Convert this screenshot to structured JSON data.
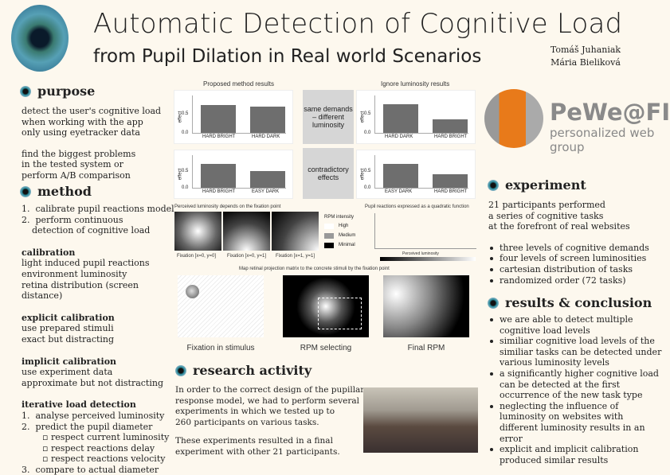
{
  "header": {
    "title": "Automatic Detection of Cognitive Load",
    "subtitle": "from Pupil Dilation in Real world Scenarios",
    "authors": [
      "Tomáš Juhaniak",
      "Mária Bieliková"
    ]
  },
  "logo": {
    "name": "PeWe@FIIT",
    "tagline": "personalized web group",
    "colors": {
      "orange": "#e87a1a",
      "gray": "#8a8a8a"
    }
  },
  "purpose": {
    "heading": "purpose",
    "p1": [
      "detect the user's cognitive load",
      "when working with the app",
      "only using eyetracker data"
    ],
    "p2": [
      "find the biggest problems",
      "in the tested system or",
      "perform A/B comparison"
    ]
  },
  "method": {
    "heading": "method",
    "steps": [
      "calibrate pupil reactions model",
      "perform continuous detection of cognitive load"
    ],
    "calibration": {
      "title": "calibration",
      "lines": [
        "light induced pupil reactions",
        "environment luminosity",
        "retina distribution (screen distance)"
      ]
    },
    "explicit": {
      "title": "explicit calibration",
      "lines": [
        "use prepared stimuli",
        "exact but distracting"
      ]
    },
    "implicit": {
      "title": "implicit calibration",
      "lines": [
        "use experiment data",
        "approximate but not distracting"
      ]
    },
    "iterative": {
      "title": "iterative load detection",
      "s1": "analyse perceived luminosity",
      "s2": "predict the pupil diameter",
      "sub": [
        "respect current luminosity",
        "respect reactions delay",
        "respect reactions velocity"
      ],
      "s3": "compare to actual diameter"
    }
  },
  "figures": {
    "proposed_title": "Proposed method results",
    "ignore_title": "Ignore luminosity results",
    "ylabel": "effect",
    "box1": "same demands – different luminosity",
    "box2": "contradictory effects",
    "charts": [
      {
        "categories": [
          "HARD BRIGHT",
          "HARD DARK"
        ],
        "values": [
          0.72,
          0.68
        ],
        "ticks": [
          "0.0",
          "0.5"
        ]
      },
      {
        "categories": [
          "HARD DARK",
          "HARD BRIGHT"
        ],
        "values": [
          0.75,
          0.35
        ],
        "ticks": [
          "0.0",
          "0.5"
        ]
      },
      {
        "categories": [
          "HARD BRIGHT",
          "EASY DARK"
        ],
        "values": [
          0.72,
          0.5
        ],
        "ticks": [
          "0.0",
          "0.5"
        ]
      },
      {
        "categories": [
          "EASY DARK",
          "HARD BRIGHT"
        ],
        "values": [
          0.72,
          0.4
        ],
        "ticks": [
          "0.0",
          "0.5"
        ]
      }
    ],
    "lum_caption": "Perceived luminosity depends on the fixation point",
    "fix_labels": [
      "Fixation [x=0, y=0]",
      "Fixation [x=0, y=1]",
      "Fixation [x=1, y=1]"
    ],
    "legend_title": "RPM intensity",
    "legend": [
      "High",
      "Medium",
      "Minimal"
    ],
    "quad_caption": "Pupil reactions expressed as a quadratic function",
    "quad_x": "Perceived luminosity",
    "map_caption": "Map retinal projection matrix to the concrete stimuli by the fixation point",
    "img_labels": [
      "Fixation in stimulus",
      "RPM selecting",
      "Final RPM"
    ]
  },
  "research": {
    "heading": "research activity",
    "p1": [
      "In order to  the correct design of the pupillary",
      "response model, we had to perform several",
      "experiments in which we tested up to",
      "260 participants on various tasks."
    ],
    "p2": [
      "These experiments resulted in a final",
      "experiment with other 21 participants."
    ]
  },
  "experiment": {
    "heading": "experiment",
    "lines": [
      "21 participants performed",
      "a series of cognitive tasks",
      "at the forefront of real websites"
    ],
    "bullets": [
      "three levels of cognitive demands",
      "four levels of screen luminosities",
      "cartesian distribution of tasks",
      "randomized order (72 tasks)"
    ]
  },
  "results": {
    "heading": "results & conclusion",
    "bullets": [
      "we are able to detect multiple cognitive load levels",
      "similiar cognitive load levels of the similiar tasks can be detected under various luminosity levels",
      "a significantly higher cognitive load can be detected at the first occurrence of the new task type",
      "neglecting the influence of luminosity on websites with different luminosity results in an error",
      "explicit and implicit calibration produced similar results"
    ]
  }
}
